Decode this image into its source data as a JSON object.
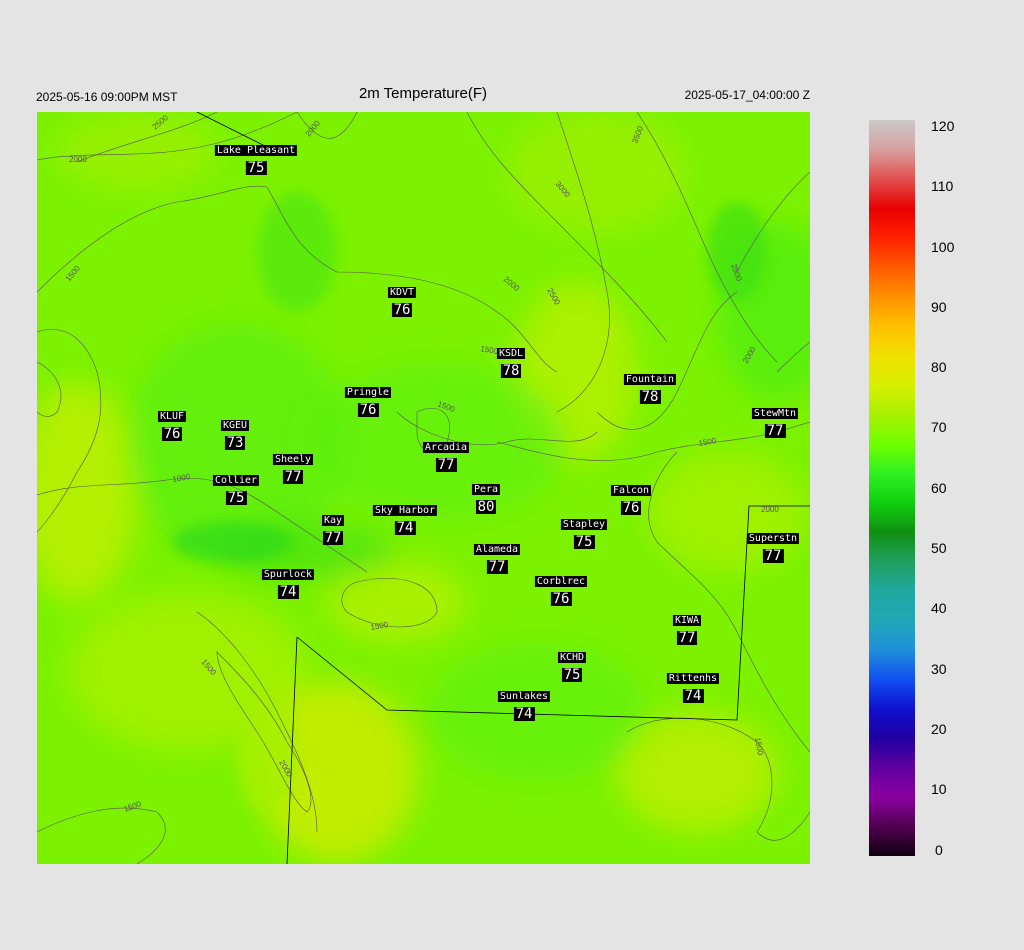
{
  "header": {
    "left": "2025-05-16 09:00PM MST",
    "title": "2m Temperature(F)",
    "right": "2025-05-17_04:00:00 Z"
  },
  "stations": [
    {
      "name": "Lake Pleasant",
      "value": "75"
    },
    {
      "name": "KDVT",
      "value": "76"
    },
    {
      "name": "KSDL",
      "value": "78"
    },
    {
      "name": "Fountain",
      "value": "78"
    },
    {
      "name": "StewMtn",
      "value": "77"
    },
    {
      "name": "Pringle",
      "value": "76"
    },
    {
      "name": "KLUF",
      "value": "76"
    },
    {
      "name": "KGEU",
      "value": "73"
    },
    {
      "name": "Arcadia",
      "value": "77"
    },
    {
      "name": "Sheely",
      "value": "77"
    },
    {
      "name": "Collier",
      "value": "75"
    },
    {
      "name": "Pera",
      "value": "80"
    },
    {
      "name": "Falcon",
      "value": "76"
    },
    {
      "name": "Kay",
      "value": "77"
    },
    {
      "name": "Sky Harbor",
      "value": "74"
    },
    {
      "name": "Stapley",
      "value": "75"
    },
    {
      "name": "Superstn",
      "value": "77"
    },
    {
      "name": "Alameda",
      "value": "77"
    },
    {
      "name": "Spurlock",
      "value": "74"
    },
    {
      "name": "Corblrec",
      "value": "76"
    },
    {
      "name": "KIWA",
      "value": "77"
    },
    {
      "name": "KCHD",
      "value": "75"
    },
    {
      "name": "Rittenhs",
      "value": "74"
    },
    {
      "name": "Sunlakes",
      "value": "74"
    }
  ],
  "contour_labels": [
    "2500",
    "2000",
    "2000",
    "3500",
    "3000",
    "1500",
    "2000",
    "2500",
    "2500",
    "1500",
    "1500",
    "2000",
    "1500",
    "1000",
    "1500",
    "1500",
    "2000",
    "1500",
    "1500",
    "2000"
  ],
  "colorbar": {
    "ticks": [
      "120",
      "110",
      "100",
      "90",
      "80",
      "70",
      "60",
      "50",
      "40",
      "30",
      "20",
      "10",
      "0"
    ],
    "colors": [
      "#c9c9c9",
      "#d8a0a0",
      "#e25050",
      "#e80000",
      "#ff2000",
      "#ff5a00",
      "#ff9000",
      "#ffc000",
      "#f0e000",
      "#d8f000",
      "#a8f000",
      "#70ff00",
      "#30f020",
      "#10d010",
      "#109010",
      "#20a060",
      "#20a8a0",
      "#20a8b8",
      "#2090d8",
      "#1050f0",
      "#1010d0",
      "#2000a0",
      "#6000a0",
      "#8a00a0",
      "#500050",
      "#100010"
    ]
  }
}
